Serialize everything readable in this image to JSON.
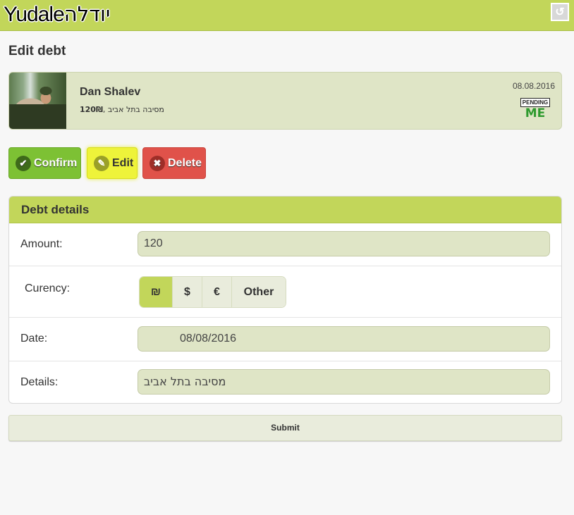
{
  "header": {
    "logo_latin": "Yudale",
    "logo_hebrew": "יודלה",
    "back_icon": "back-arrow-icon"
  },
  "page": {
    "title": "Edit debt"
  },
  "profile": {
    "name": "Dan Shalev",
    "amount": "120₪",
    "description": "מסיבה בתל אביב",
    "separator": ", ",
    "date": "08.08.2016",
    "status_badge": "PENDING",
    "status_who": "ME"
  },
  "actions": {
    "confirm": "Confirm",
    "edit": "Edit",
    "delete": "Delete"
  },
  "details": {
    "title": "Debt details",
    "amount_label": "Amount:",
    "amount_value": "120",
    "currency_label": "Curency:",
    "currency_options": [
      "₪",
      "$",
      "€",
      "Other"
    ],
    "currency_selected": "₪",
    "date_label": "Date:",
    "date_value": "08/08/2016",
    "details_label": "Details:",
    "details_value": "מסיבה בתל אביב"
  },
  "submit": {
    "label": "Submit"
  },
  "colors": {
    "accent": "#c2d65a",
    "confirm": "#7dc134",
    "edit": "#eef33a",
    "delete": "#e0524a"
  }
}
